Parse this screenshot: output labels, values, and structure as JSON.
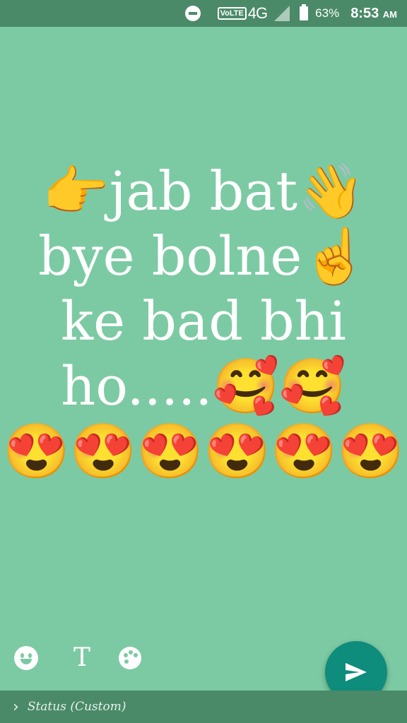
{
  "status_bar": {
    "volte": "VoLTE",
    "network": "4G",
    "battery_percent": "63%",
    "time": "8:53",
    "ampm": "AM"
  },
  "status_text": {
    "line1": "👉jab bat👋",
    "line2": "bye bolne☝️",
    "line3": " ke bad bhi",
    "line4": "ho.....🥰🥰",
    "line5": "😍😍😍😍😍😍"
  },
  "tools": {
    "text_tool_label": "T"
  },
  "bottom_bar": {
    "label": "Status (Custom)",
    "chevron": "›"
  },
  "colors": {
    "background": "#7ccaa3",
    "bars": "#4a8a68",
    "send": "#0e8c7c"
  },
  "icons": [
    "do-not-disturb-icon",
    "signal-icon",
    "battery-icon",
    "emoji-icon",
    "text-icon",
    "palette-icon",
    "send-icon",
    "chevron-right-icon"
  ]
}
